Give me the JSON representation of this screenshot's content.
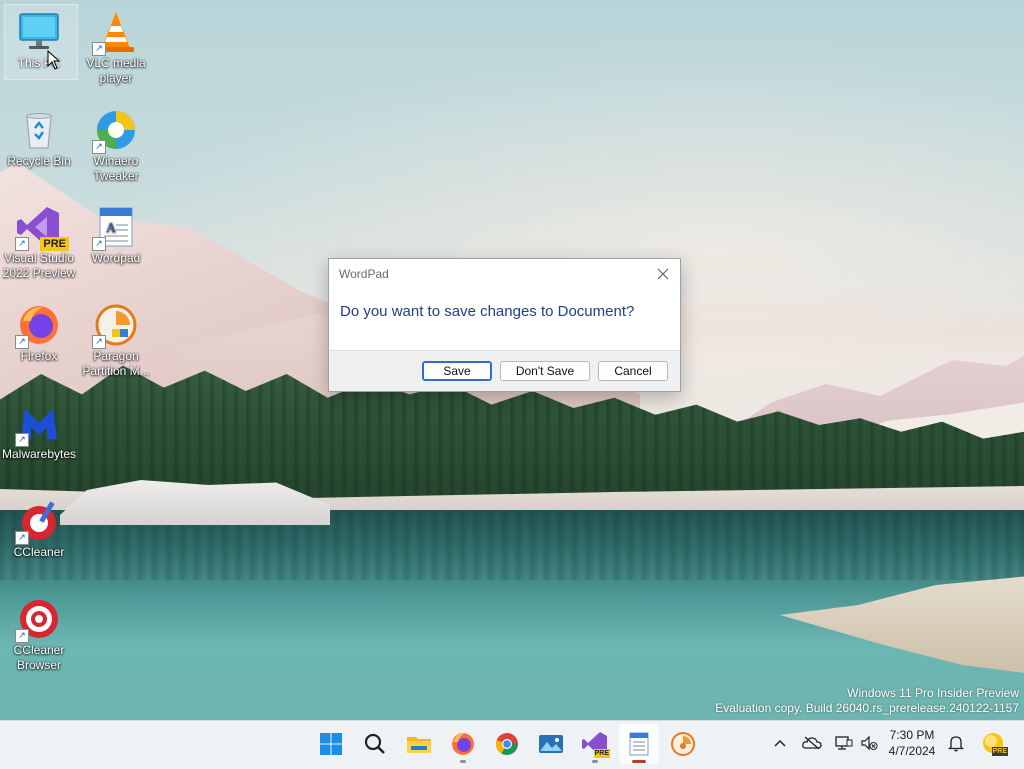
{
  "desktop": {
    "icons": [
      {
        "label": "This PC"
      },
      {
        "label": "VLC media player"
      },
      {
        "label": "Recycle Bin"
      },
      {
        "label": "Winaero Tweaker"
      },
      {
        "label": "Visual Studio 2022 Preview",
        "badge": "PRE"
      },
      {
        "label": "Wordpad"
      },
      {
        "label": "Firefox"
      },
      {
        "label": "Paragon Partition M..."
      },
      {
        "label": "Malwarebytes"
      },
      {
        "label": "CCleaner"
      },
      {
        "label": "CCleaner Browser"
      }
    ]
  },
  "dialog": {
    "title": "WordPad",
    "message": "Do you want to save changes to Document?",
    "buttons": {
      "save": "Save",
      "dont_save": "Don't Save",
      "cancel": "Cancel"
    }
  },
  "watermark": {
    "line1": "Windows 11 Pro Insider Preview",
    "line2": "Evaluation copy. Build 26040.rs_prerelease.240122-1157"
  },
  "taskbar": {
    "pinned": [
      "start-icon",
      "search-icon",
      "file-explorer-icon",
      "firefox-icon",
      "chrome-icon",
      "photos-icon",
      "visual-studio-preview-icon",
      "wordpad-icon",
      "paragon-icon"
    ],
    "vs_badge": "PRE",
    "tray": {
      "time": "7:30 PM",
      "date": "4/7/2024"
    }
  },
  "colors": {
    "accent": "#2d6cd1",
    "dialog_message": "#1f3f8a",
    "taskbar": "#eef2f5"
  }
}
